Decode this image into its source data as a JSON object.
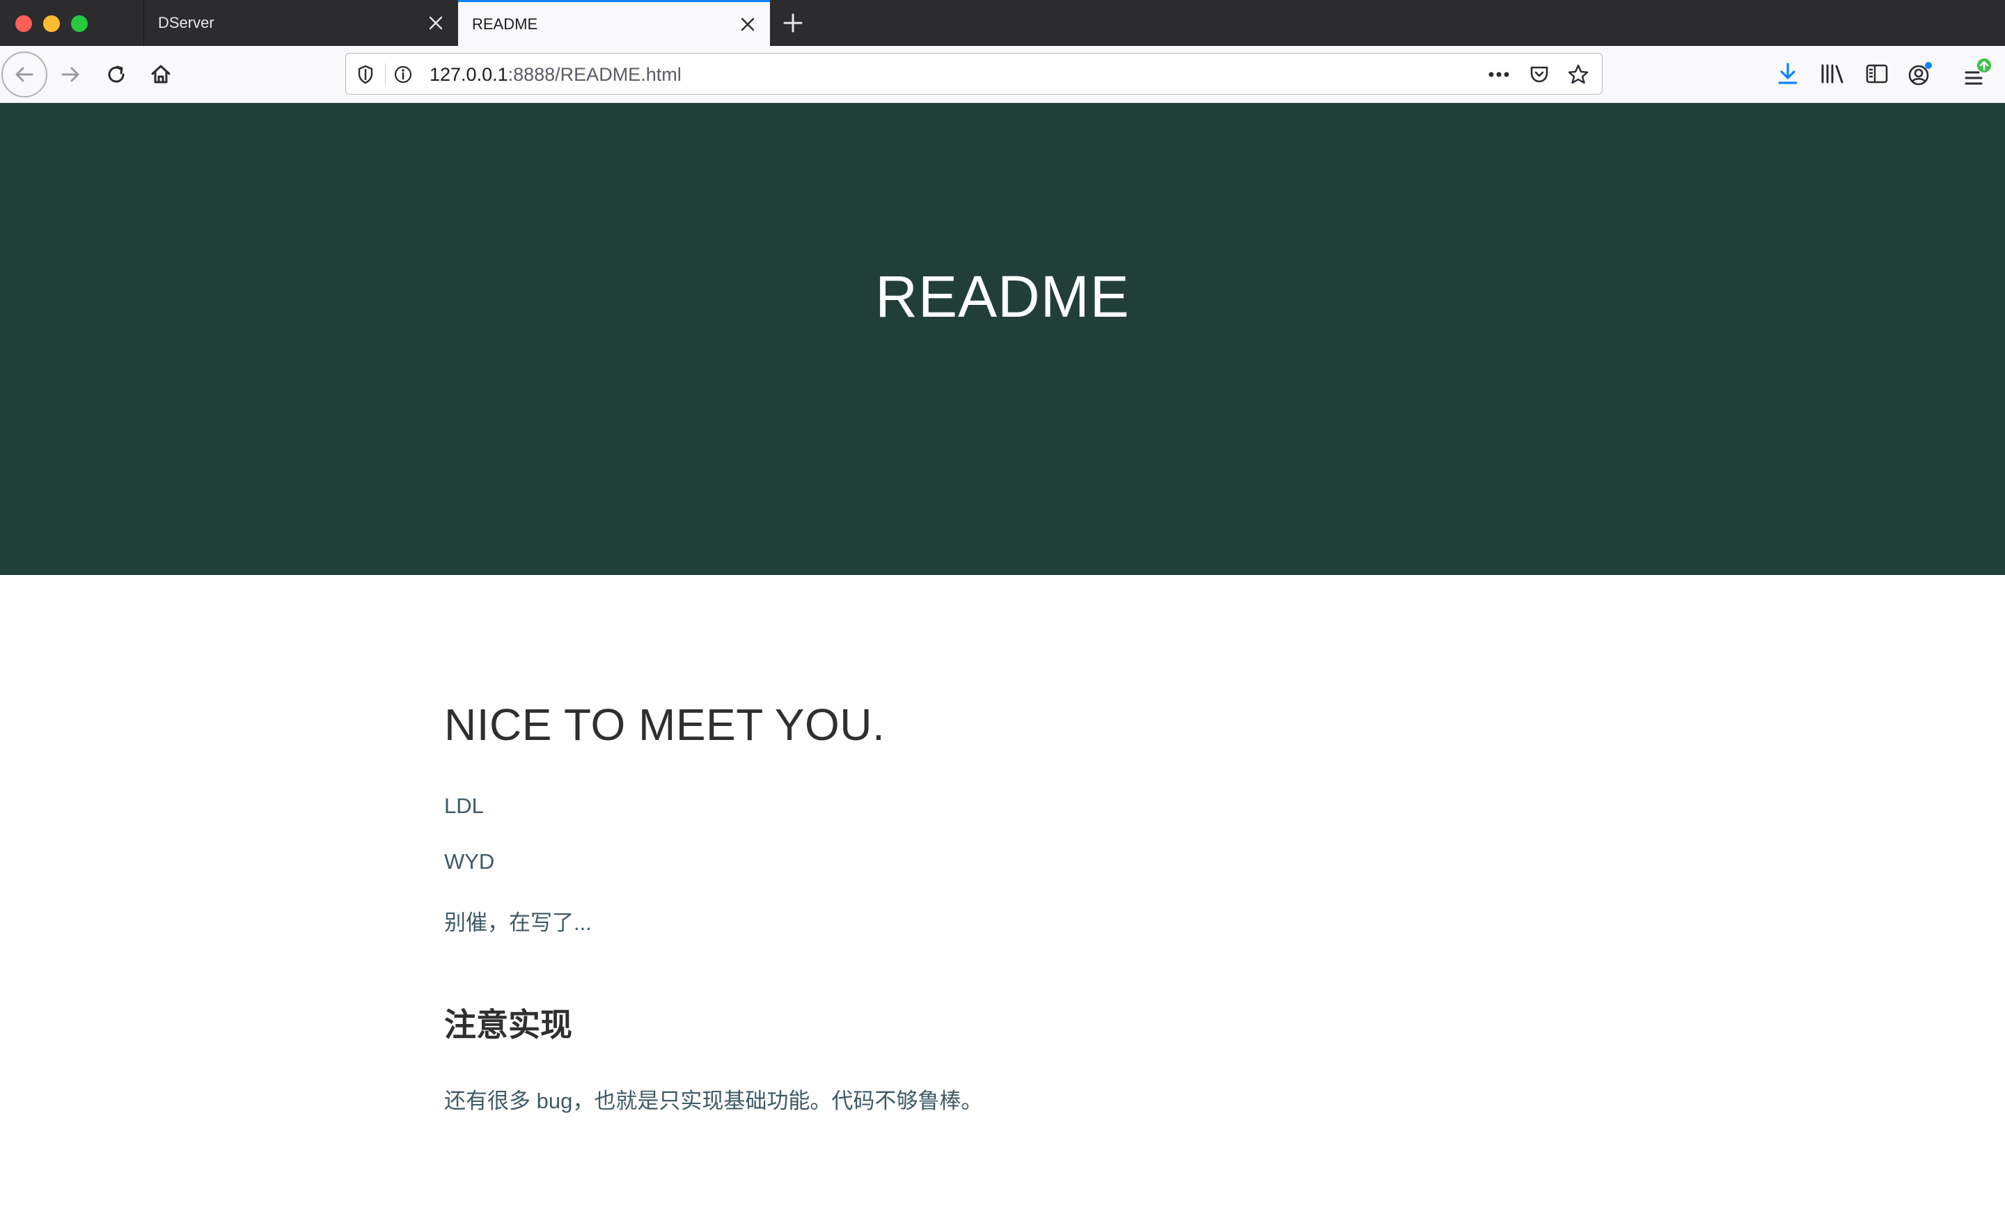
{
  "browser": {
    "tabs": [
      {
        "label": "DServer",
        "active": false
      },
      {
        "label": "README",
        "active": true
      }
    ],
    "url": {
      "host": "127.0.0.1",
      "path": ":8888/README.html"
    }
  },
  "page": {
    "hero_title": "README",
    "heading": "NICE TO MEET YOU.",
    "paragraphs": [
      "LDL",
      "WYD",
      "别催，在写了..."
    ],
    "subheading": "注意实现",
    "note": "还有很多 bug，也就是只实现基础功能。代码不够鲁棒。"
  },
  "colors": {
    "hero_bg": "#213f38",
    "accent_blue": "#0a84ff",
    "text_link": "#3e5a66"
  }
}
